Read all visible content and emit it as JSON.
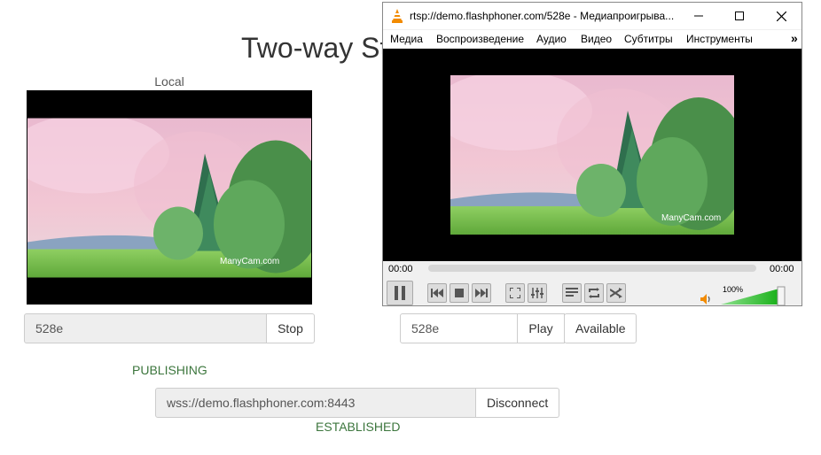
{
  "page": {
    "title": "Two-way Str",
    "local_label": "Local",
    "publish": {
      "stream_name": "528e",
      "stop_label": "Stop",
      "status": "PUBLISHING"
    },
    "play": {
      "stream_name": "528e",
      "play_label": "Play",
      "available_label": "Available"
    },
    "connection": {
      "url": "wss://demo.flashphoner.com:8443",
      "disconnect_label": "Disconnect",
      "status": "ESTABLISHED"
    },
    "watermark": "ManyCam.com"
  },
  "vlc": {
    "title": "rtsp://demo.flashphoner.com/528e - Медиапроигрыва...",
    "menu": [
      "Медиа",
      "Воспроизведение",
      "Аудио",
      "Видео",
      "Субтитры",
      "Инструменты"
    ],
    "menu_more": "»",
    "time_elapsed": "00:00",
    "time_total": "00:00",
    "volume": "100%",
    "seek_progress": 0,
    "volume_level": 1.0
  },
  "colors": {
    "status_green": "#3c763d",
    "vlc_orange": "#f28b00",
    "volume_green": "#2bbf2b"
  }
}
